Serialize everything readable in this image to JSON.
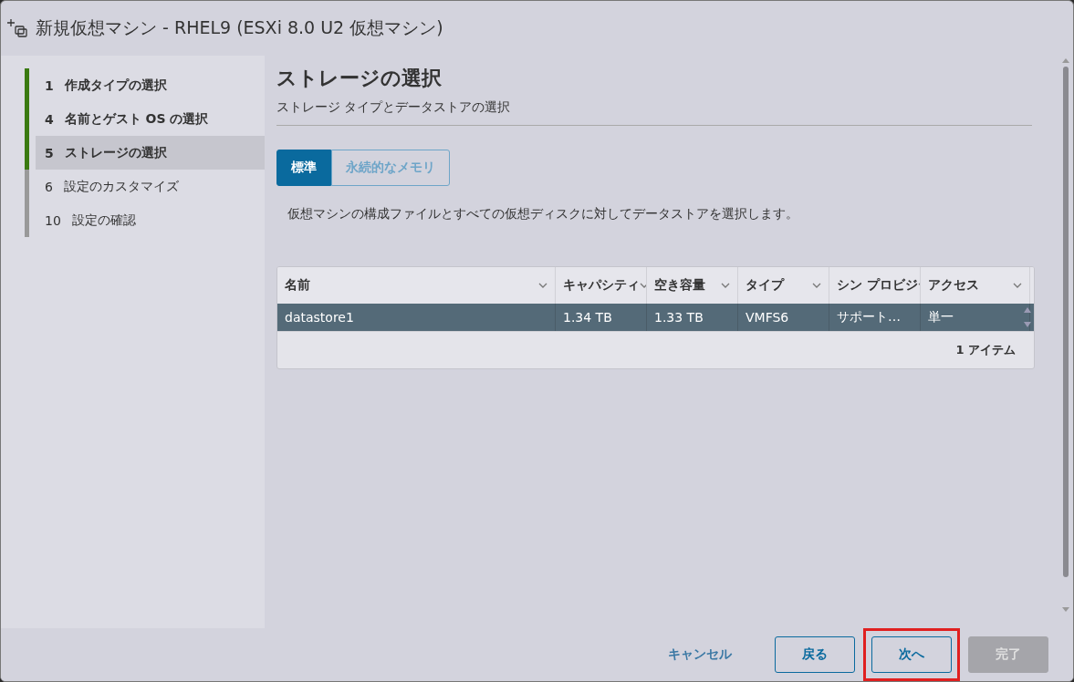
{
  "window": {
    "title": "新規仮想マシン - RHEL9 (ESXi 8.0 U2 仮想マシン)"
  },
  "steps": [
    {
      "number": "1",
      "label": "作成タイプの選択",
      "completed": true,
      "selected": false
    },
    {
      "number": "4",
      "label": "名前とゲスト OS の選択",
      "completed": true,
      "selected": false
    },
    {
      "number": "5",
      "label": "ストレージの選択",
      "completed": false,
      "selected": true
    },
    {
      "number": "6",
      "label": "設定のカスタマイズ",
      "completed": false,
      "selected": false
    },
    {
      "number": "10",
      "label": "設定の確認",
      "completed": false,
      "selected": false
    }
  ],
  "page": {
    "title": "ストレージの選択",
    "subtitle": "ストレージ タイプとデータストアの選択"
  },
  "tabs": [
    {
      "label": "標準",
      "selected": true
    },
    {
      "label": "永続的なメモリ",
      "selected": false
    }
  ],
  "description": "仮想マシンの構成ファイルとすべての仮想ディスクに対してデータストアを選択します。",
  "table": {
    "columns": [
      "名前",
      "キャパシティ",
      "空き容量",
      "タイプ",
      "シン プロビジ",
      "アクセス"
    ],
    "rows": [
      {
        "cells": [
          "datastore1",
          "1.34 TB",
          "1.33 TB",
          "VMFS6",
          "サポート…",
          "単一"
        ],
        "selected": true
      }
    ],
    "footer": "1 アイテム"
  },
  "buttons": [
    {
      "label": "キャンセル",
      "kind": "link",
      "disabled": false,
      "highlighted": false
    },
    {
      "label": "戻る",
      "kind": "outline",
      "disabled": false,
      "highlighted": false
    },
    {
      "label": "次へ",
      "kind": "outline",
      "disabled": false,
      "highlighted": true
    },
    {
      "label": "完了",
      "kind": "primary",
      "disabled": true,
      "highlighted": false
    }
  ]
}
